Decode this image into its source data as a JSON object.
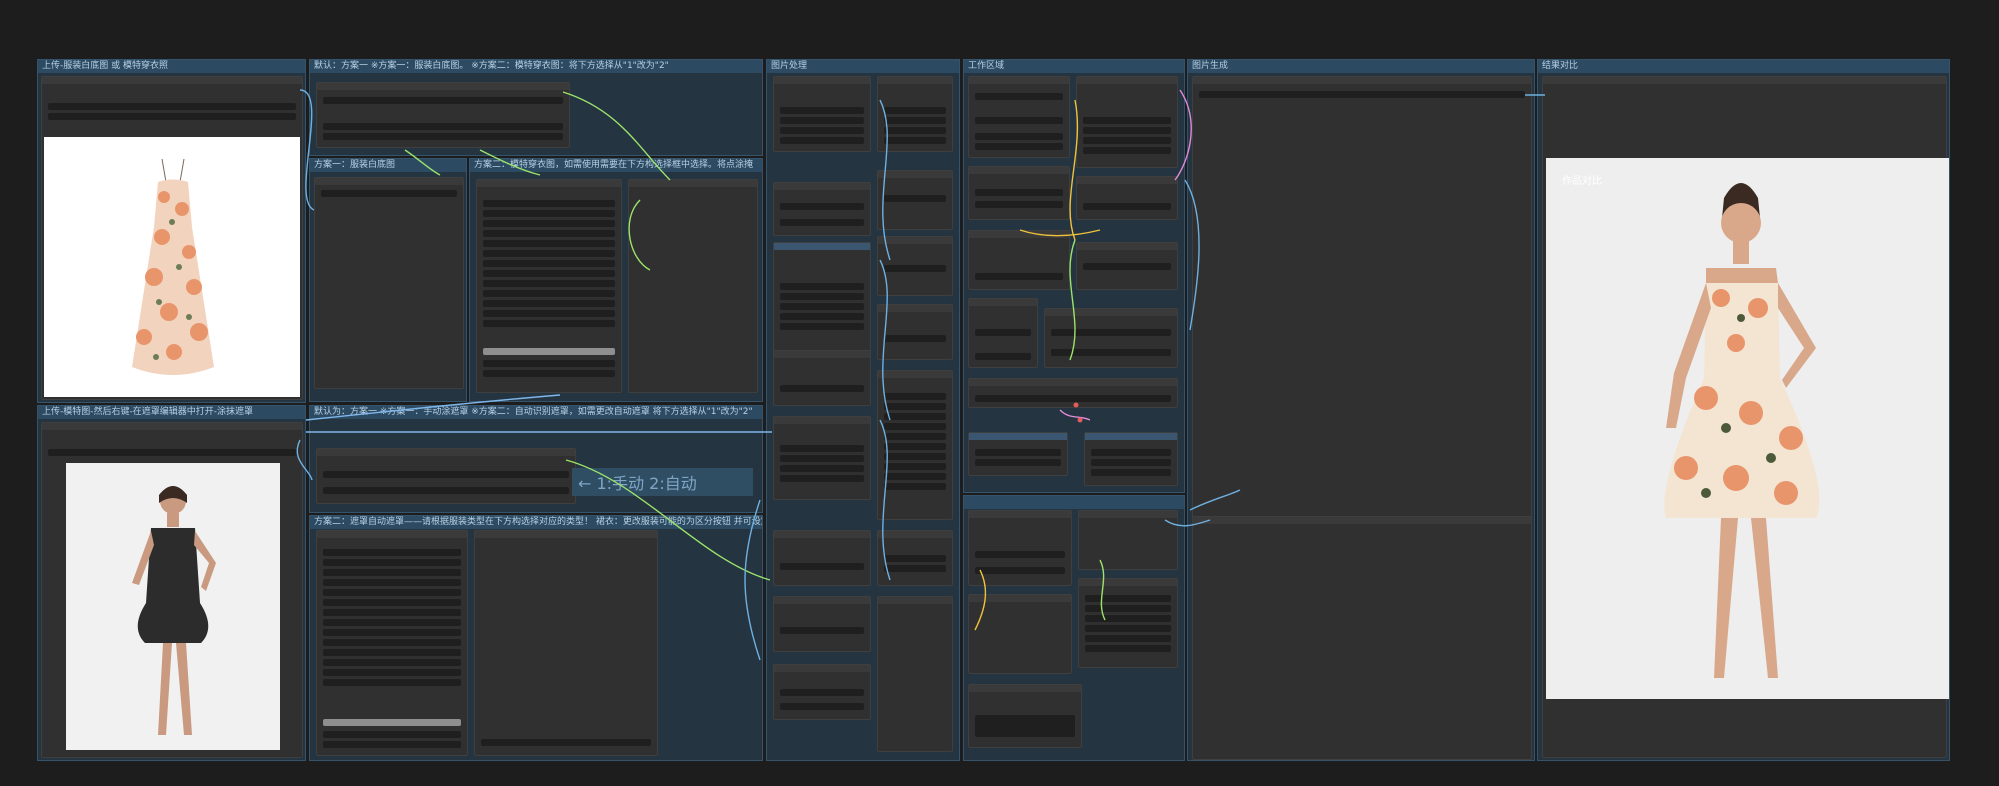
{
  "groups": {
    "upload_garment": "上传-服装白底图 或 模特穿衣照",
    "default_scheme": "默认：方案一    ※方案一：服装白底图。      ※方案二：模特穿衣图：将下方选择从\"1\"改为\"2\"",
    "scheme1_white": "方案一：服装白底图",
    "scheme2_model": "方案二：模特穿衣图，如需使用需要在下方构选择框中选择。将点涂掩",
    "upload_model": "上传-模特图-然后右键-在遮罩编辑器中打开-涂抹遮罩",
    "default_mask": "默认为：方案一    ※方案一：手动涂遮罩                    ※方案二：自动识别遮罩，如需更改自动遮罩 将下方选择从\"1\"改为\"2\"",
    "scheme2_auto": "方案二：遮罩自动遮罩——请根据服装类型在下方构选择对应的类型！ 裙衣：更改服装可能的为区分按钮 并可设定为遮罩",
    "image_processing": "图片处理",
    "workspace": "工作区域",
    "generate": "图片生成",
    "result": "结果对比"
  },
  "mode_switch_label": "← 1:手动  2:自动",
  "watermark": "作品对比"
}
